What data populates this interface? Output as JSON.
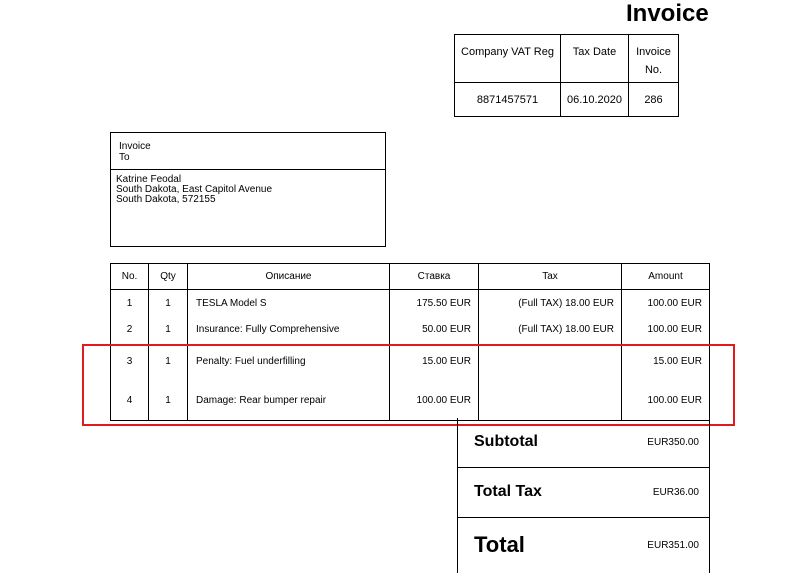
{
  "title": "Invoice",
  "meta": {
    "vat_label": "Company VAT Reg",
    "tax_date_label": "Tax Date",
    "invoice_no_label_1": "Invoice",
    "invoice_no_label_2": "No.",
    "vat_value": "8871457571",
    "tax_date_value": "06.10.2020",
    "invoice_no_value": "286"
  },
  "bill_to": {
    "label_line1": "Invoice",
    "label_line2": "To",
    "name": "Katrine Feodal",
    "address_line1": "South Dakota, East Capitol Avenue",
    "address_line2": "South Dakota, 572155"
  },
  "items": {
    "headers": {
      "no": "No.",
      "qty": "Qty",
      "description": "Описание",
      "rate": "Ставка",
      "tax": "Tax",
      "amount": "Amount"
    },
    "rows": [
      {
        "no": "1",
        "qty": "1",
        "description": "TESLA Model S",
        "rate": "175.50 EUR",
        "tax": "(Full TAX) 18.00 EUR",
        "amount": "100.00 EUR"
      },
      {
        "no": "2",
        "qty": "1",
        "description": "Insurance: Fully Comprehensive",
        "rate": "50.00 EUR",
        "tax": "(Full TAX) 18.00 EUR",
        "amount": "100.00 EUR"
      },
      {
        "no": "3",
        "qty": "1",
        "description": "Penalty: Fuel underfilling",
        "rate": "15.00 EUR",
        "tax": "",
        "amount": "15.00 EUR"
      },
      {
        "no": "4",
        "qty": "1",
        "description": "Damage: Rear bumper repair",
        "rate": "100.00 EUR",
        "tax": "",
        "amount": "100.00 EUR"
      }
    ]
  },
  "totals": {
    "subtotal_label": "Subtotal",
    "subtotal_value": "EUR350.00",
    "total_tax_label": "Total Tax",
    "total_tax_value": "EUR36.00",
    "total_label": "Total",
    "total_value": "EUR351.00"
  },
  "highlight": {
    "color": "#e11b1b"
  }
}
